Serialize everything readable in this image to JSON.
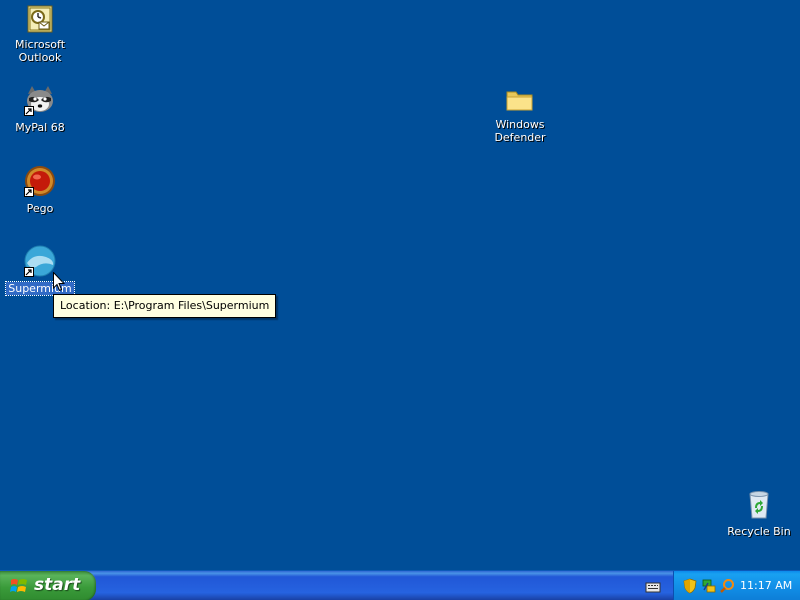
{
  "desktop": {
    "background_color": "#004e98",
    "icons": [
      {
        "label_line1": "Microsoft",
        "label_line2": "Outlook",
        "icon": "outlook-icon"
      },
      {
        "label_line1": "MyPal 68",
        "icon": "mypal-raccoon-icon"
      },
      {
        "label_line1": "Pego",
        "icon": "pego-icon"
      },
      {
        "label_line1": "Supermium",
        "icon": "supermium-icon",
        "selected": true
      },
      {
        "label_line1": "Windows",
        "label_line2": "Defender",
        "icon": "folder-icon"
      },
      {
        "label_line1": "Recycle Bin",
        "icon": "recycle-bin-icon"
      }
    ],
    "tooltip": "Location: E:\\Program Files\\Supermium"
  },
  "taskbar": {
    "start_label": "start",
    "tray_icons": [
      "security-shield-icon",
      "network-icon",
      "search-icon"
    ],
    "quick_icon": "keyboard-icon",
    "clock": "11:17 AM"
  }
}
